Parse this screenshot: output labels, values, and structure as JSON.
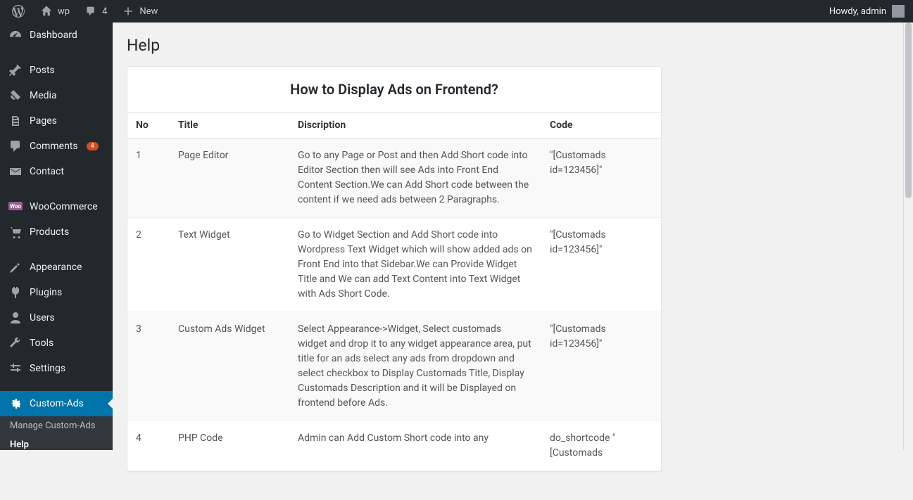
{
  "adminbar": {
    "site_name": "wp",
    "comments_count": "4",
    "new_label": "New",
    "howdy": "Howdy, admin"
  },
  "sidebar": {
    "items": [
      {
        "key": "dashboard",
        "label": "Dashboard"
      },
      {
        "key": "posts",
        "label": "Posts"
      },
      {
        "key": "media",
        "label": "Media"
      },
      {
        "key": "pages",
        "label": "Pages"
      },
      {
        "key": "comments",
        "label": "Comments",
        "badge": "4"
      },
      {
        "key": "contact",
        "label": "Contact"
      },
      {
        "key": "woocommerce",
        "label": "WooCommerce"
      },
      {
        "key": "products",
        "label": "Products"
      },
      {
        "key": "appearance",
        "label": "Appearance"
      },
      {
        "key": "plugins",
        "label": "Plugins"
      },
      {
        "key": "users",
        "label": "Users"
      },
      {
        "key": "tools",
        "label": "Tools"
      },
      {
        "key": "settings",
        "label": "Settings"
      },
      {
        "key": "customads",
        "label": "Custom-Ads"
      }
    ],
    "submenu": [
      {
        "label": "Manage Custom-Ads"
      },
      {
        "label": "Help"
      }
    ]
  },
  "page": {
    "title": "Help",
    "heading": "How to Display Ads on Frontend?",
    "columns": {
      "no": "No",
      "title": "Title",
      "desc": "Discription",
      "code": "Code"
    },
    "rows": [
      {
        "no": "1",
        "title": "Page Editor",
        "desc": "Go to any Page or Post and then Add Short code into Editor Section then will see Ads into Front End Content Section.We can Add Short code between the content if we need ads between 2 Paragraphs.",
        "code": "\"[Customads id=123456]\""
      },
      {
        "no": "2",
        "title": "Text Widget",
        "desc": "Go to Widget Section and Add Short code into Wordpress Text Widget which will show added ads on Front End into that Sidebar.We can Provide Widget Title and We can add Text Content into Text Widget with Ads Short Code.",
        "code": "\"[Customads id=123456]\""
      },
      {
        "no": "3",
        "title": "Custom Ads Widget",
        "desc": "Select Appearance->Widget, Select customads widget and drop it to any widget appearance area, put title for an ads select any ads from dropdown and select checkbox to Display Customads Title, Display Customads Description and it will be Displayed on frontend before Ads.",
        "code": "\"[Customads id=123456]\""
      },
      {
        "no": "4",
        "title": "PHP Code",
        "desc": "Admin can Add Custom Short code into any",
        "code": "do_shortcode \"[Customads"
      }
    ]
  }
}
